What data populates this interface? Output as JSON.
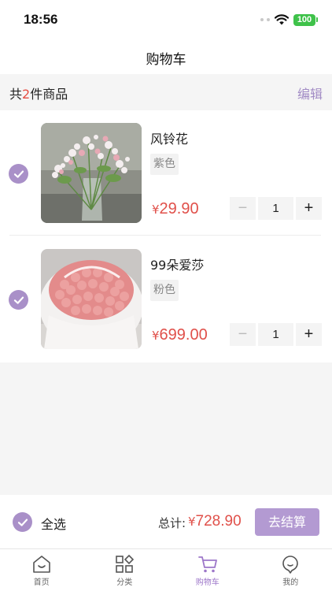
{
  "status_bar": {
    "time": "18:56",
    "battery": "100"
  },
  "nav": {
    "title": "购物车"
  },
  "summary": {
    "prefix": "共",
    "count": "2",
    "suffix": "件商品",
    "edit_label": "编辑"
  },
  "items": [
    {
      "name": "风铃花",
      "spec": "紫色",
      "currency": "¥",
      "price": "29.90",
      "quantity": "1"
    },
    {
      "name": "99朵爱莎",
      "spec": "粉色",
      "currency": "¥",
      "price": "699.00",
      "quantity": "1"
    }
  ],
  "stepper": {
    "minus": "−",
    "plus": "+"
  },
  "checkout": {
    "select_all_label": "全选",
    "total_label": "总计:",
    "currency": "¥",
    "total": "728.90",
    "button_label": "去结算"
  },
  "tabs": [
    {
      "label": "首页",
      "icon": "home-icon",
      "active": false
    },
    {
      "label": "分类",
      "icon": "category-icon",
      "active": false
    },
    {
      "label": "购物车",
      "icon": "cart-icon",
      "active": true
    },
    {
      "label": "我的",
      "icon": "profile-icon",
      "active": false
    }
  ],
  "colors": {
    "accent": "#a990c8",
    "price": "#e0504a",
    "checkout_button": "#b39ad2",
    "active_tab": "#9d77c9"
  }
}
